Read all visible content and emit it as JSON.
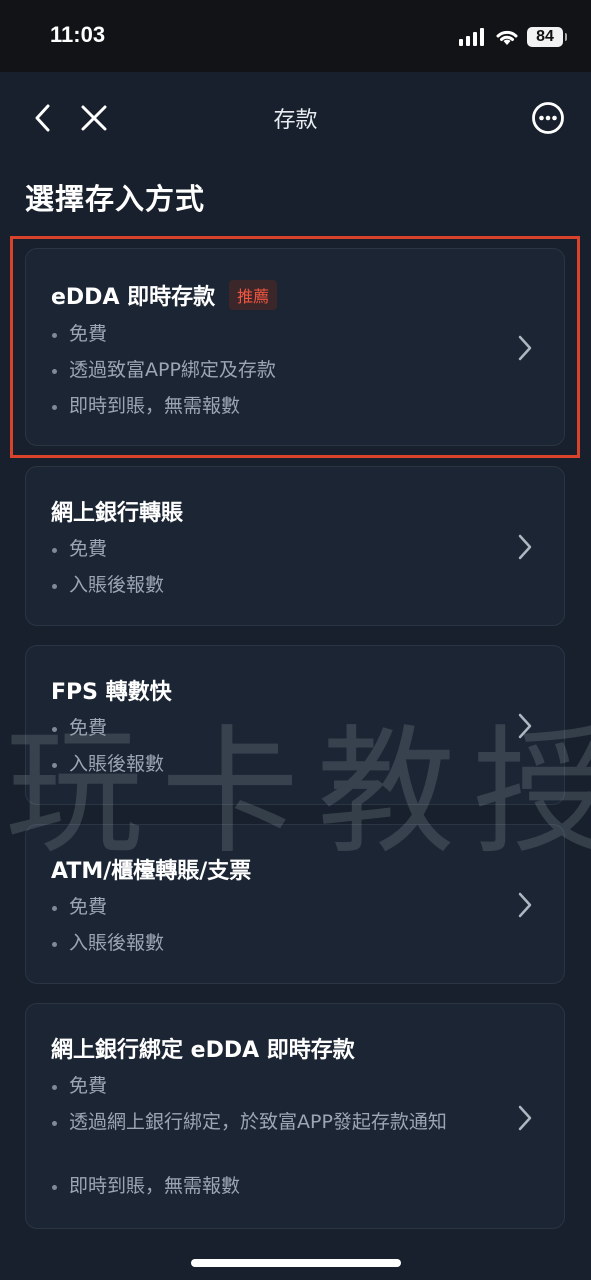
{
  "status_bar": {
    "time": "11:03",
    "battery": "84"
  },
  "nav": {
    "title": "存款"
  },
  "heading": "選擇存入方式",
  "options": [
    {
      "title": "eDDA 即時存款",
      "badge": "推薦",
      "bullets": [
        "免費",
        "透過致富APP綁定及存款",
        "即時到賬，無需報數"
      ],
      "highlighted": true
    },
    {
      "title": "網上銀行轉賬",
      "bullets": [
        "免費",
        "入賬後報數"
      ]
    },
    {
      "title": "FPS 轉數快",
      "bullets": [
        "免費",
        "入賬後報數"
      ]
    },
    {
      "title": "ATM/櫃檯轉賬/支票",
      "bullets": [
        "免費",
        "入賬後報數"
      ]
    },
    {
      "title": "網上銀行綁定 eDDA 即時存款",
      "bullets": [
        "免費",
        "透過網上銀行綁定，於致富APP發起存款通知",
        "即時到賬，無需報數"
      ]
    }
  ],
  "watermark": "玩卡教授",
  "colors": {
    "background": "#17202c",
    "card": "#1b2533",
    "badge_text": "#f0553f",
    "highlight_border": "#d9432c"
  }
}
